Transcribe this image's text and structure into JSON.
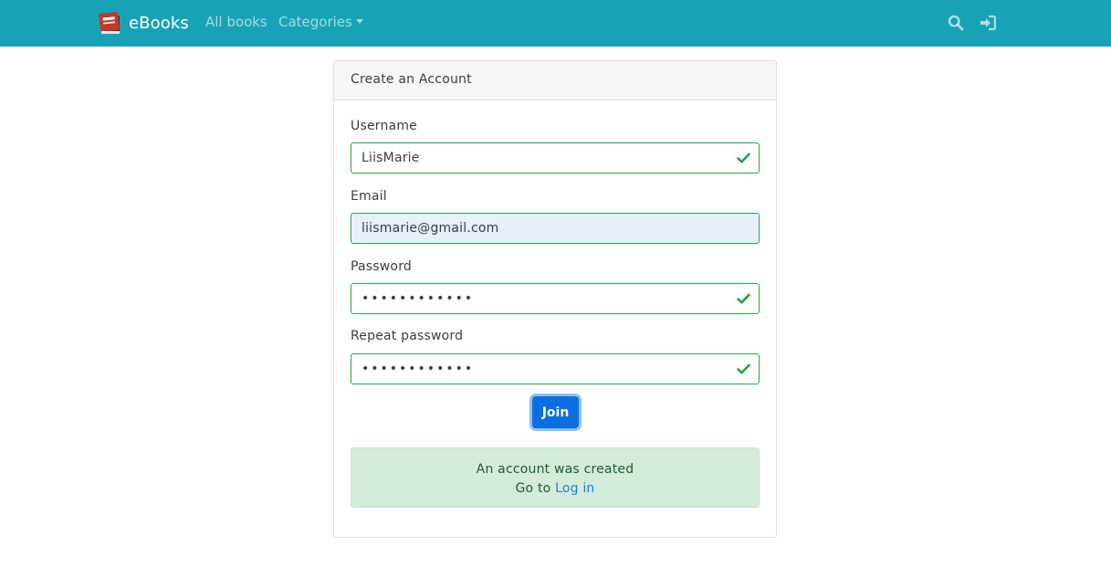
{
  "navbar": {
    "brand": "eBooks",
    "links": [
      {
        "label": "All books"
      },
      {
        "label": "Categories"
      }
    ],
    "icons": [
      "search-icon",
      "sign-in-icon"
    ],
    "color": "#17a2b8"
  },
  "form": {
    "title": "Create an Account",
    "fields": [
      {
        "label": "Username",
        "value": "LiisMarie",
        "valid": true
      },
      {
        "label": "Email",
        "value": "liismarie@gmail.com",
        "valid": true
      },
      {
        "label": "Password",
        "value": "••••••••••••",
        "valid": true
      },
      {
        "label": "Repeat password",
        "value": "••••••••••••",
        "valid": true
      }
    ],
    "submit_label": "Join"
  },
  "alert": {
    "message": "An account was created",
    "goto_prefix": "Go to",
    "login_link": "Log in"
  },
  "colors": {
    "valid_border": "#28a745",
    "primary_button": "#0b6fe0",
    "alert_background": "#d4eddb"
  }
}
